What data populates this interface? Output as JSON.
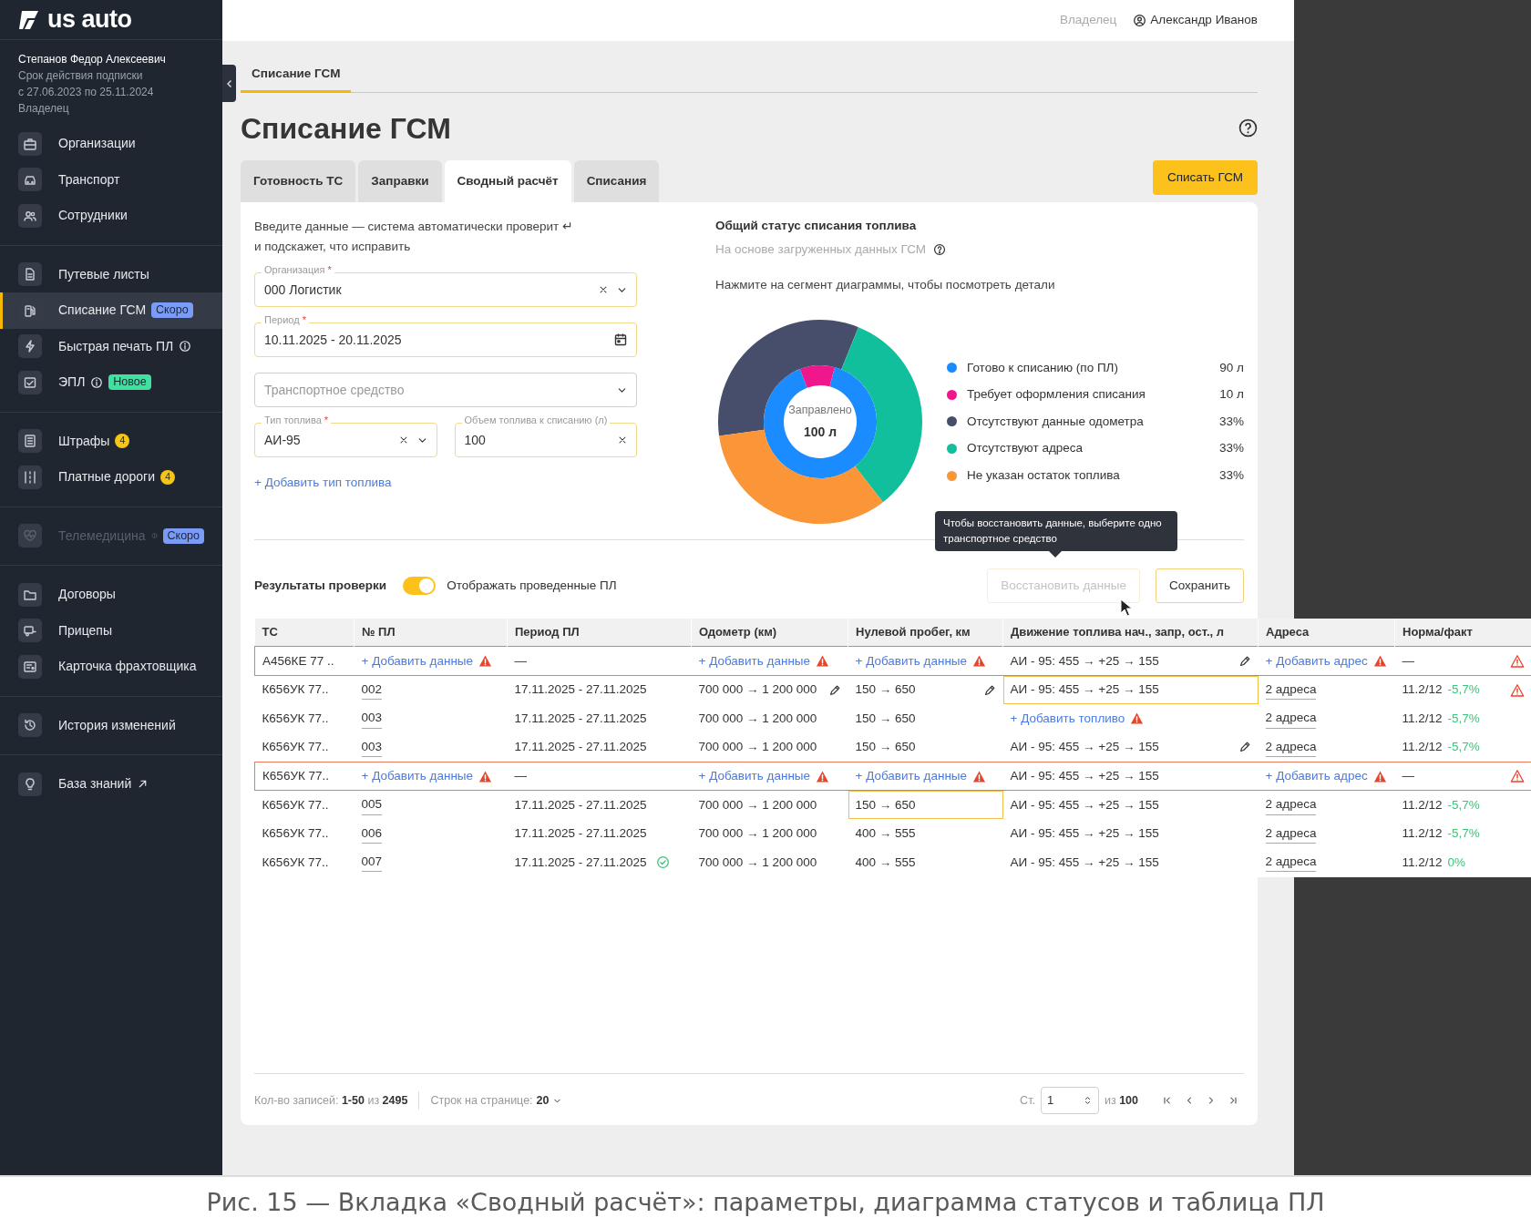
{
  "sidebar": {
    "logo": "us auto",
    "account": {
      "name": "Степанов Федор Алексеевич",
      "subscription_label": "Срок действия подписки",
      "subscription_period": "с 27.06.2023 по 25.11.2024",
      "role": "Владелец"
    },
    "groups": [
      [
        {
          "label": "Организации",
          "selected": false,
          "disabled": false
        },
        {
          "label": "Транспорт",
          "selected": false,
          "disabled": false
        },
        {
          "label": "Сотрудники",
          "selected": false,
          "disabled": false
        }
      ],
      [
        {
          "label": "Путевые листы",
          "selected": false,
          "disabled": false
        },
        {
          "label": "Списание ГСМ",
          "selected": true,
          "disabled": false,
          "badge": {
            "text": "Скоро",
            "color": "#7b9cf6"
          }
        },
        {
          "label": "Быстрая печать ПЛ",
          "selected": false,
          "disabled": false,
          "info": true
        },
        {
          "label": "ЭПЛ",
          "selected": false,
          "disabled": false,
          "info": true,
          "badge": {
            "text": "Новое",
            "color": "#3fe0a0"
          }
        }
      ],
      [
        {
          "label": "Штрафы",
          "selected": false,
          "disabled": false,
          "count": "4"
        },
        {
          "label": "Платные дороги",
          "selected": false,
          "disabled": false,
          "count": "4"
        }
      ],
      [
        {
          "label": "Телемедицина",
          "selected": false,
          "disabled": true,
          "info": true,
          "badge": {
            "text": "Скоро",
            "color": "#7b9cf6"
          }
        }
      ],
      [
        {
          "label": "Договоры",
          "selected": false,
          "disabled": false
        },
        {
          "label": "Прицепы",
          "selected": false,
          "disabled": false
        },
        {
          "label": "Карточка фрахтовщика",
          "selected": false,
          "disabled": false
        }
      ],
      [
        {
          "label": "История изменений",
          "selected": false,
          "disabled": false
        }
      ],
      [
        {
          "label": "База знаний",
          "selected": false,
          "disabled": false,
          "external": true
        }
      ]
    ]
  },
  "header": {
    "role": "Владелец",
    "user": "Александр Иванов"
  },
  "page_tabs": [
    {
      "label": "Списание ГСМ",
      "selected": true
    }
  ],
  "title": "Списание ГСМ",
  "tabs": [
    {
      "label": "Готовность ТС",
      "selected": false
    },
    {
      "label": "Заправки",
      "selected": false
    },
    {
      "label": "Сводный расчёт",
      "selected": true
    },
    {
      "label": "Списания",
      "selected": false
    }
  ],
  "primary_button": "Списать ГСМ",
  "form": {
    "hint_lines": [
      "Введите данные — система автоматически проверит ↵",
      "и подскажет, что исправить"
    ],
    "rows": [
      [
        {
          "kind": "select",
          "label": "Организация",
          "required_mark": "*",
          "value": "000 Логистик",
          "clearable": true
        }
      ],
      [
        {
          "kind": "date",
          "label": "Период",
          "required_mark": "*",
          "value": "10.11.2025 - 20.11.2025"
        }
      ],
      [
        {
          "kind": "select",
          "placeholder": "Транспортное средство"
        }
      ],
      [
        {
          "kind": "select",
          "label": "Тип топлива",
          "required_mark": "*",
          "value": "АИ-95",
          "clearable": true
        },
        {
          "kind": "text",
          "label": "Объем топлива к списанию (л)",
          "value": "100",
          "clearable": true
        }
      ]
    ],
    "add_link": "+ Добавить тип топлива"
  },
  "status": {
    "title": "Общий статус списания топлива",
    "subtitle": "На основе загруженных данных ГСМ",
    "instruction": "Нажмите на сегмент диаграммы, чтобы посмотреть детали",
    "center_label": "Заправлено",
    "center_value": "100 л",
    "legend": [
      {
        "label": "Готово к списанию (по ПЛ)",
        "value": "90 л",
        "color": "#1a8cff"
      },
      {
        "label": "Требует оформления списания",
        "value": "10 л",
        "color": "#f0168c"
      },
      {
        "label": "Отсутствуют данные одометра",
        "value": "33%",
        "color": "#474e6b"
      },
      {
        "label": "Отсутствуют адреса",
        "value": "33%",
        "color": "#12bf9c"
      },
      {
        "label": "Не указан остаток топлива",
        "value": "33%",
        "color": "#fb9638"
      }
    ],
    "chart_data": {
      "type": "donut",
      "series": [
        {
          "colors": [
            "#1a8cff",
            "#f0168c"
          ],
          "values": [
            90,
            10
          ]
        },
        {
          "colors": [
            "#474e6b",
            "#12bf9c",
            "#fb9638"
          ],
          "values": [
            33,
            33,
            33
          ]
        }
      ]
    }
  },
  "tooltip": {
    "text": "Чтобы восстановить данные, выберите одно транспортное средство"
  },
  "results": {
    "title": "Результаты проверки",
    "toggle": {
      "label": "Отображать проведенные ПЛ",
      "on": true
    },
    "buttons": [
      {
        "label": "Восстановить данные",
        "disabled": true
      },
      {
        "label": "Сохранить",
        "disabled": false
      }
    ]
  },
  "table": {
    "columns": [
      "ТС",
      "№ ПЛ",
      "Период ПЛ",
      "Одометр (км)",
      "Нулевой пробег, км",
      "Движение топлива нач., запр, ост., л",
      "Адреса",
      "Норма/факт"
    ],
    "rows": [
      {
        "error": true,
        "alert": true,
        "cells": [
          {
            "kind": "text",
            "text": "А456КЕ 77 .."
          },
          {
            "kind": "add",
            "text": "+ Добавить данные",
            "warn": true
          },
          {
            "kind": "dash",
            "text": "—"
          },
          {
            "kind": "add",
            "text": "+ Добавить данные",
            "warn": true
          },
          {
            "kind": "add",
            "text": "+ Добавить данные",
            "warn": true
          },
          {
            "kind": "text",
            "text": "АИ - 95: 455 → +25 → 155",
            "edit": true
          },
          {
            "kind": "add",
            "text": "+ Добавить адрес",
            "warn": true
          },
          {
            "kind": "dash",
            "text": "—"
          }
        ]
      },
      {
        "error": false,
        "alert": true,
        "cells": [
          {
            "kind": "text",
            "text": "К656УК 77.."
          },
          {
            "kind": "link",
            "text": "002"
          },
          {
            "kind": "text",
            "text": "17.11.2025 - 27.11.2025"
          },
          {
            "kind": "text",
            "text": "700 000 → 1 200 000",
            "edit": true
          },
          {
            "kind": "text",
            "text": "150 → 650",
            "edit": true
          },
          {
            "kind": "text",
            "text": "АИ - 95: 455 → +25 → 155",
            "highlighted": true
          },
          {
            "kind": "link",
            "text": "2 адреса"
          },
          {
            "kind": "norm",
            "text": "11.2/12",
            "delta": "-5,7%"
          }
        ]
      },
      {
        "error": false,
        "alert": false,
        "cells": [
          {
            "kind": "text",
            "text": "К656УК 77.."
          },
          {
            "kind": "link",
            "text": "003"
          },
          {
            "kind": "text",
            "text": "17.11.2025 - 27.11.2025"
          },
          {
            "kind": "text",
            "text": "700 000 → 1 200 000"
          },
          {
            "kind": "text",
            "text": "150 → 650"
          },
          {
            "kind": "add",
            "text": "+ Добавить топливо",
            "warn": true
          },
          {
            "kind": "link",
            "text": "2 адреса"
          },
          {
            "kind": "norm",
            "text": "11.2/12",
            "delta": "-5,7%"
          }
        ]
      },
      {
        "error": false,
        "alert": false,
        "cells": [
          {
            "kind": "text",
            "text": "К656УК 77.."
          },
          {
            "kind": "link",
            "text": "003"
          },
          {
            "kind": "text",
            "text": "17.11.2025 - 27.11.2025"
          },
          {
            "kind": "text",
            "text": "700 000 → 1 200 000"
          },
          {
            "kind": "text",
            "text": "150 → 650"
          },
          {
            "kind": "text",
            "text": "АИ - 95: 455 → +25 → 155",
            "edit": true
          },
          {
            "kind": "link",
            "text": "2 адреса"
          },
          {
            "kind": "norm",
            "text": "11.2/12",
            "delta": "-5,7%"
          }
        ]
      },
      {
        "error": true,
        "alert": true,
        "cells": [
          {
            "kind": "text",
            "text": "К656УК 77.."
          },
          {
            "kind": "add",
            "text": "+ Добавить данные",
            "warn": true
          },
          {
            "kind": "dash",
            "text": "—"
          },
          {
            "kind": "add",
            "text": "+ Добавить данные",
            "warn": true
          },
          {
            "kind": "add",
            "text": "+ Добавить данные",
            "warn": true
          },
          {
            "kind": "text",
            "text": "АИ - 95: 455 → +25 → 155"
          },
          {
            "kind": "add",
            "text": "+ Добавить адрес",
            "warn": true
          },
          {
            "kind": "dash",
            "text": "—"
          }
        ]
      },
      {
        "error": false,
        "alert": false,
        "cells": [
          {
            "kind": "text",
            "text": "К656УК 77.."
          },
          {
            "kind": "link",
            "text": "005"
          },
          {
            "kind": "text",
            "text": "17.11.2025 - 27.11.2025"
          },
          {
            "kind": "text",
            "text": "700 000 → 1 200 000"
          },
          {
            "kind": "text",
            "text": "150 → 650",
            "highlighted": true
          },
          {
            "kind": "text",
            "text": "АИ - 95: 455 → +25 → 155"
          },
          {
            "kind": "link",
            "text": "2 адреса"
          },
          {
            "kind": "norm",
            "text": "11.2/12",
            "delta": "-5,7%"
          }
        ]
      },
      {
        "error": false,
        "alert": false,
        "cells": [
          {
            "kind": "text",
            "text": "К656УК 77.."
          },
          {
            "kind": "link",
            "text": "006"
          },
          {
            "kind": "text",
            "text": "17.11.2025 - 27.11.2025"
          },
          {
            "kind": "text",
            "text": "700 000 → 1 200 000"
          },
          {
            "kind": "text",
            "text": "400 → 555"
          },
          {
            "kind": "text",
            "text": "АИ - 95: 455 → +25 → 155"
          },
          {
            "kind": "link",
            "text": "2 адреса"
          },
          {
            "kind": "norm",
            "text": "11.2/12",
            "delta": "-5,7%"
          }
        ]
      },
      {
        "error": false,
        "alert": false,
        "cells": [
          {
            "kind": "text",
            "text": "К656УК 77.."
          },
          {
            "kind": "link",
            "text": "007"
          },
          {
            "kind": "text",
            "text": "17.11.2025 - 27.11.2025",
            "ok": true
          },
          {
            "kind": "text",
            "text": "700 000 → 1 200 000"
          },
          {
            "kind": "text",
            "text": "400 → 555"
          },
          {
            "kind": "text",
            "text": "АИ - 95: 455 → +25 → 155"
          },
          {
            "kind": "link",
            "text": "2 адреса"
          },
          {
            "kind": "norm",
            "text": "11.2/12",
            "delta": "0%"
          }
        ]
      }
    ]
  },
  "pagination": {
    "records": "Кол-во записей: **1-50** из **2495**",
    "page_size_label": "Строк на странице:",
    "page_size": "20",
    "page_label": "Ст.",
    "page": "1",
    "total": "из **100**"
  },
  "caption": "Рис. 15 — Вкладка «Сводный расчёт»: параметры, диаграмма статусов и таблица ПЛ"
}
